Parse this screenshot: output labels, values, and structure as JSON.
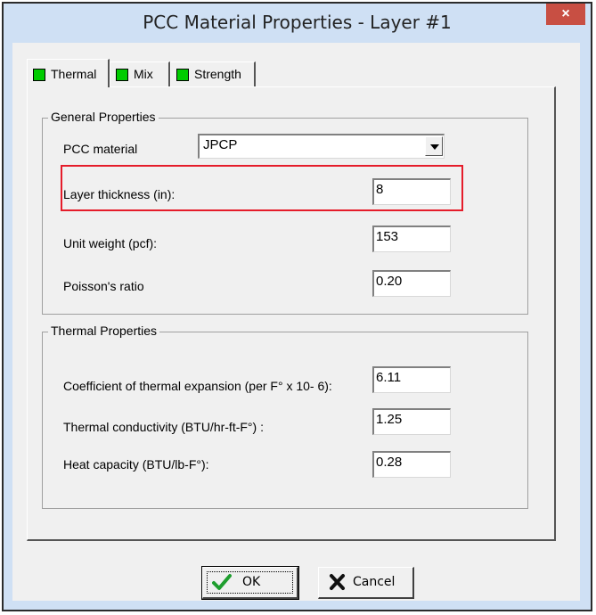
{
  "window": {
    "title": "PCC Material Properties - Layer #1",
    "close_glyph": "×"
  },
  "tabs": [
    {
      "label": "Thermal",
      "status_color": "#00cc00",
      "active": true
    },
    {
      "label": "Mix",
      "status_color": "#00cc00",
      "active": false
    },
    {
      "label": "Strength",
      "status_color": "#00cc00",
      "active": false
    }
  ],
  "general": {
    "title": "General Properties",
    "pcc_material": {
      "label": "PCC material",
      "value": "JPCP"
    },
    "layer_thickness": {
      "label": "Layer thickness (in):",
      "value": "8"
    },
    "unit_weight": {
      "label": "Unit weight (pcf):",
      "value": "153"
    },
    "poisson": {
      "label": "Poisson's ratio",
      "value": "0.20"
    }
  },
  "thermal": {
    "title": "Thermal Properties",
    "cte": {
      "label": "Coefficient of thermal expansion (per F° x 10- 6):",
      "value": "6.11"
    },
    "conductivity": {
      "label": "Thermal conductivity (BTU/hr-ft-F°) :",
      "value": "1.25"
    },
    "heat_capacity": {
      "label": "Heat capacity (BTU/lb-F°):",
      "value": "0.28"
    }
  },
  "buttons": {
    "ok": "OK",
    "cancel": "Cancel"
  },
  "colors": {
    "highlight": "#e51c2a",
    "tab_status": "#00cc00",
    "titlebar": "#cfe0f4",
    "close": "#c84f43"
  },
  "icons": {
    "ok": "checkmark-icon",
    "cancel": "x-mark-icon"
  }
}
